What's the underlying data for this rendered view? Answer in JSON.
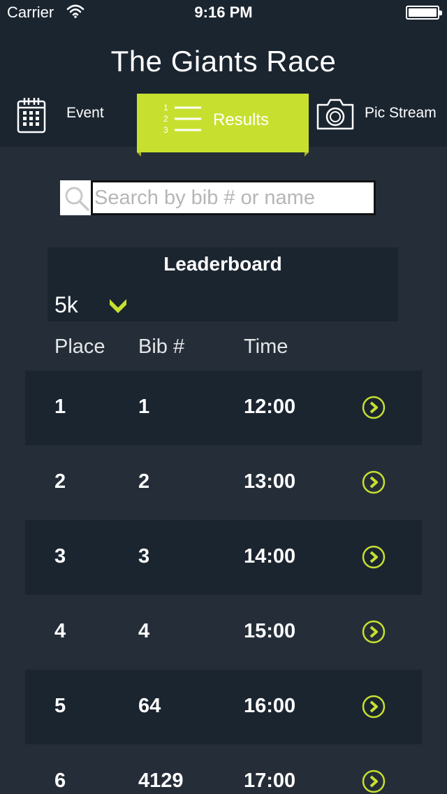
{
  "status": {
    "carrier": "Carrier",
    "time": "9:16 PM"
  },
  "header": {
    "title": "The Giants Race"
  },
  "tabs": {
    "event": "Event",
    "results": "Results",
    "pics": "Pic Stream",
    "results_numbers": [
      "1",
      "2",
      "3"
    ]
  },
  "search": {
    "placeholder": "Search by bib # or name",
    "value": ""
  },
  "leaderboard": {
    "title": "Leaderboard",
    "distance": "5k"
  },
  "columns": {
    "place": "Place",
    "bib": "Bib #",
    "time": "Time"
  },
  "results": [
    {
      "place": "1",
      "bib": "1",
      "time": "12:00"
    },
    {
      "place": "2",
      "bib": "2",
      "time": "13:00"
    },
    {
      "place": "3",
      "bib": "3",
      "time": "14:00"
    },
    {
      "place": "4",
      "bib": "4",
      "time": "15:00"
    },
    {
      "place": "5",
      "bib": "64",
      "time": "16:00"
    },
    {
      "place": "6",
      "bib": "4129",
      "time": "17:00"
    }
  ],
  "colors": {
    "accent": "#c7e02f",
    "background": "#252e38",
    "header": "#1b2530"
  }
}
